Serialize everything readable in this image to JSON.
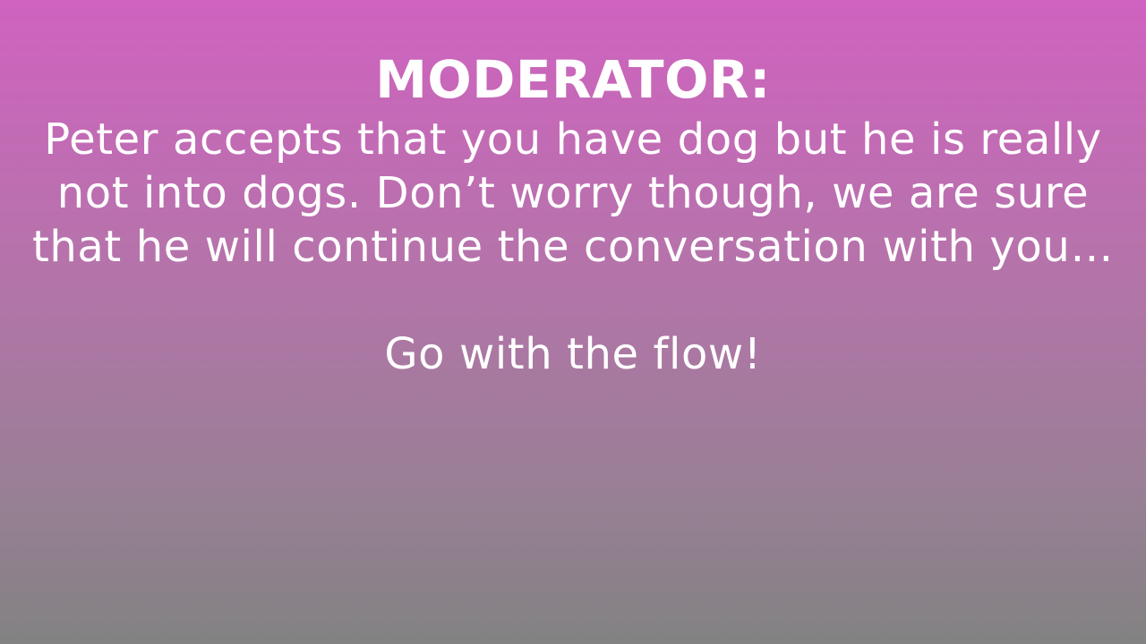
{
  "slide": {
    "title": "MODERATOR:",
    "message": "Peter accepts that you have dog but he is really not into dogs. Don’t worry though, we are sure that he will continue the conversation with you…",
    "closing": "Go with the flow!"
  },
  "colors": {
    "gradient_top": "#d062c0",
    "gradient_bottom": "#828282",
    "text": "#ffffff"
  }
}
